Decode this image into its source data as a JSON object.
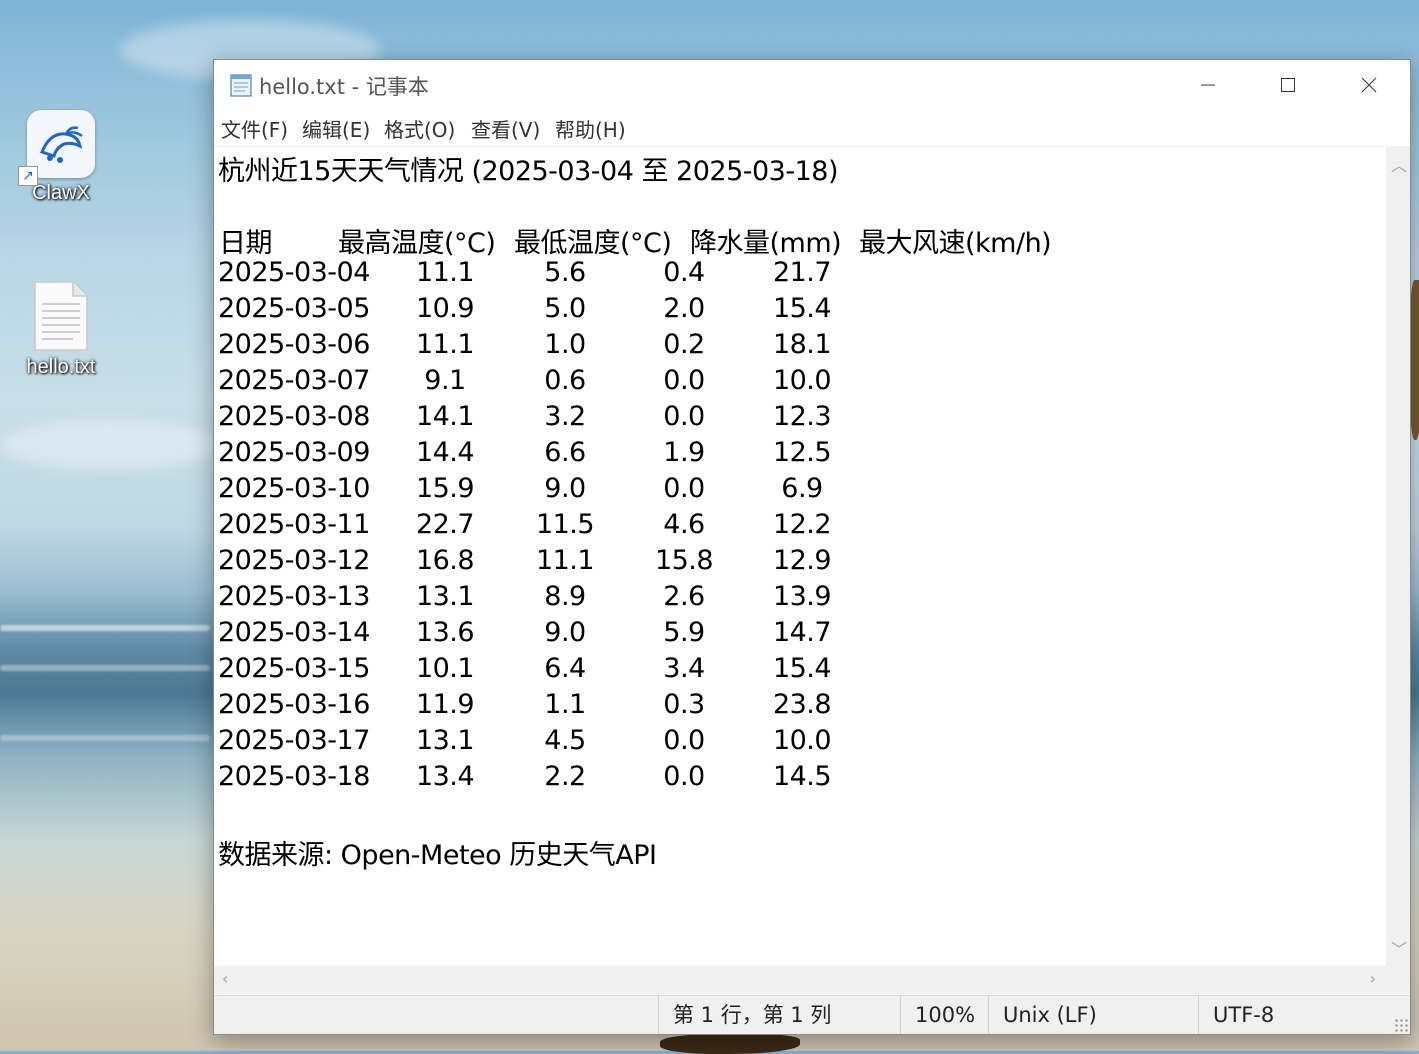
{
  "desktop": {
    "icons": [
      {
        "label": "ClawX",
        "icon": "claw-app-icon"
      },
      {
        "label": "hello.txt",
        "icon": "text-file-icon"
      }
    ]
  },
  "window": {
    "title": "hello.txt - 记事本",
    "menu": [
      "文件(F)",
      "编辑(E)",
      "格式(O)",
      "查看(V)",
      "帮助(H)"
    ],
    "buttons": {
      "minimize": "minimize-icon",
      "maximize": "maximize-icon",
      "close": "close-icon"
    }
  },
  "document": {
    "title_line": "杭州近15天天气情况 (2025-03-04 至 2025-03-18)",
    "headers": [
      "日期",
      "最高温度(°C)",
      "最低温度(°C)",
      "降水量(mm)",
      "最大风速(km/h)"
    ],
    "rows": [
      [
        "2025-03-04",
        "11.1",
        "5.6",
        "0.4",
        "21.7"
      ],
      [
        "2025-03-05",
        "10.9",
        "5.0",
        "2.0",
        "15.4"
      ],
      [
        "2025-03-06",
        "11.1",
        "1.0",
        "0.2",
        "18.1"
      ],
      [
        "2025-03-07",
        "9.1",
        "0.6",
        "0.0",
        "10.0"
      ],
      [
        "2025-03-08",
        "14.1",
        "3.2",
        "0.0",
        "12.3"
      ],
      [
        "2025-03-09",
        "14.4",
        "6.6",
        "1.9",
        "12.5"
      ],
      [
        "2025-03-10",
        "15.9",
        "9.0",
        "0.0",
        "6.9"
      ],
      [
        "2025-03-11",
        "22.7",
        "11.5",
        "4.6",
        "12.2"
      ],
      [
        "2025-03-12",
        "16.8",
        "11.1",
        "15.8",
        "12.9"
      ],
      [
        "2025-03-13",
        "13.1",
        "8.9",
        "2.6",
        "13.9"
      ],
      [
        "2025-03-14",
        "13.6",
        "9.0",
        "5.9",
        "14.7"
      ],
      [
        "2025-03-15",
        "10.1",
        "6.4",
        "3.4",
        "15.4"
      ],
      [
        "2025-03-16",
        "11.9",
        "1.1",
        "0.3",
        "23.8"
      ],
      [
        "2025-03-17",
        "13.1",
        "4.5",
        "0.0",
        "10.0"
      ],
      [
        "2025-03-18",
        "13.4",
        "2.2",
        "0.0",
        "14.5"
      ]
    ],
    "footer_line": "数据来源: Open-Meteo 历史天气API"
  },
  "status": {
    "position": "第 1 行，第 1 列",
    "zoom": "100%",
    "line_ending": "Unix (LF)",
    "encoding": "UTF-8"
  }
}
